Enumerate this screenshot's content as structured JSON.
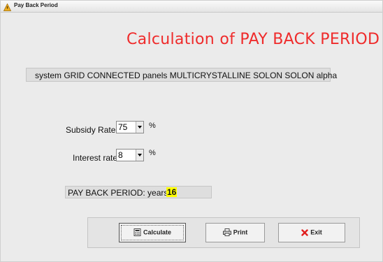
{
  "window": {
    "title": "Pay Back Period"
  },
  "heading": "Calculation of PAY BACK PERIOD",
  "system_description": "system GRID CONNECTED panels MULTICRYSTALLINE SOLON SOLON alpha",
  "subsidy": {
    "label": "Subsidy Rate",
    "value": "75",
    "unit": "%"
  },
  "interest": {
    "label": "Interest rate",
    "value": "8",
    "unit": "%"
  },
  "result": {
    "label": "PAY BACK PERIOD: years",
    "value": "16"
  },
  "buttons": {
    "calculate": {
      "label": "Calculate",
      "icon": "calculator-icon"
    },
    "print": {
      "label": "Print",
      "icon": "printer-icon"
    },
    "exit": {
      "label": "Exit",
      "icon": "red-x-icon"
    }
  },
  "colors": {
    "heading": "#ef2b2b",
    "highlight": "#ffff00",
    "exit_icon": "#e02020"
  }
}
